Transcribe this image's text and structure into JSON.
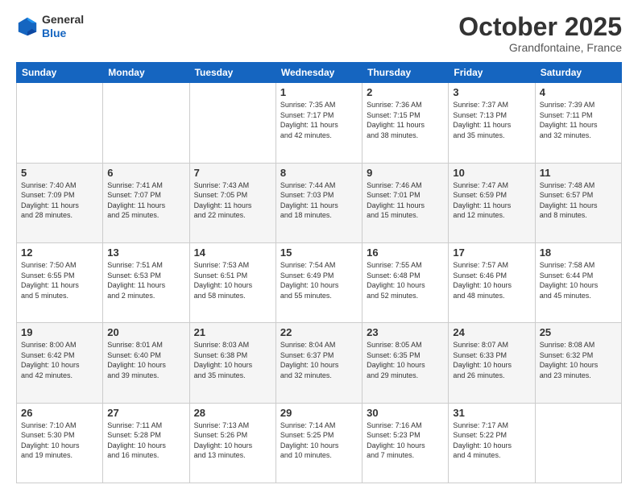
{
  "header": {
    "logo_line1": "General",
    "logo_line2": "Blue",
    "month": "October 2025",
    "location": "Grandfontaine, France"
  },
  "days_of_week": [
    "Sunday",
    "Monday",
    "Tuesday",
    "Wednesday",
    "Thursday",
    "Friday",
    "Saturday"
  ],
  "weeks": [
    [
      {
        "day": "",
        "info": ""
      },
      {
        "day": "",
        "info": ""
      },
      {
        "day": "",
        "info": ""
      },
      {
        "day": "1",
        "info": "Sunrise: 7:35 AM\nSunset: 7:17 PM\nDaylight: 11 hours\nand 42 minutes."
      },
      {
        "day": "2",
        "info": "Sunrise: 7:36 AM\nSunset: 7:15 PM\nDaylight: 11 hours\nand 38 minutes."
      },
      {
        "day": "3",
        "info": "Sunrise: 7:37 AM\nSunset: 7:13 PM\nDaylight: 11 hours\nand 35 minutes."
      },
      {
        "day": "4",
        "info": "Sunrise: 7:39 AM\nSunset: 7:11 PM\nDaylight: 11 hours\nand 32 minutes."
      }
    ],
    [
      {
        "day": "5",
        "info": "Sunrise: 7:40 AM\nSunset: 7:09 PM\nDaylight: 11 hours\nand 28 minutes."
      },
      {
        "day": "6",
        "info": "Sunrise: 7:41 AM\nSunset: 7:07 PM\nDaylight: 11 hours\nand 25 minutes."
      },
      {
        "day": "7",
        "info": "Sunrise: 7:43 AM\nSunset: 7:05 PM\nDaylight: 11 hours\nand 22 minutes."
      },
      {
        "day": "8",
        "info": "Sunrise: 7:44 AM\nSunset: 7:03 PM\nDaylight: 11 hours\nand 18 minutes."
      },
      {
        "day": "9",
        "info": "Sunrise: 7:46 AM\nSunset: 7:01 PM\nDaylight: 11 hours\nand 15 minutes."
      },
      {
        "day": "10",
        "info": "Sunrise: 7:47 AM\nSunset: 6:59 PM\nDaylight: 11 hours\nand 12 minutes."
      },
      {
        "day": "11",
        "info": "Sunrise: 7:48 AM\nSunset: 6:57 PM\nDaylight: 11 hours\nand 8 minutes."
      }
    ],
    [
      {
        "day": "12",
        "info": "Sunrise: 7:50 AM\nSunset: 6:55 PM\nDaylight: 11 hours\nand 5 minutes."
      },
      {
        "day": "13",
        "info": "Sunrise: 7:51 AM\nSunset: 6:53 PM\nDaylight: 11 hours\nand 2 minutes."
      },
      {
        "day": "14",
        "info": "Sunrise: 7:53 AM\nSunset: 6:51 PM\nDaylight: 10 hours\nand 58 minutes."
      },
      {
        "day": "15",
        "info": "Sunrise: 7:54 AM\nSunset: 6:49 PM\nDaylight: 10 hours\nand 55 minutes."
      },
      {
        "day": "16",
        "info": "Sunrise: 7:55 AM\nSunset: 6:48 PM\nDaylight: 10 hours\nand 52 minutes."
      },
      {
        "day": "17",
        "info": "Sunrise: 7:57 AM\nSunset: 6:46 PM\nDaylight: 10 hours\nand 48 minutes."
      },
      {
        "day": "18",
        "info": "Sunrise: 7:58 AM\nSunset: 6:44 PM\nDaylight: 10 hours\nand 45 minutes."
      }
    ],
    [
      {
        "day": "19",
        "info": "Sunrise: 8:00 AM\nSunset: 6:42 PM\nDaylight: 10 hours\nand 42 minutes."
      },
      {
        "day": "20",
        "info": "Sunrise: 8:01 AM\nSunset: 6:40 PM\nDaylight: 10 hours\nand 39 minutes."
      },
      {
        "day": "21",
        "info": "Sunrise: 8:03 AM\nSunset: 6:38 PM\nDaylight: 10 hours\nand 35 minutes."
      },
      {
        "day": "22",
        "info": "Sunrise: 8:04 AM\nSunset: 6:37 PM\nDaylight: 10 hours\nand 32 minutes."
      },
      {
        "day": "23",
        "info": "Sunrise: 8:05 AM\nSunset: 6:35 PM\nDaylight: 10 hours\nand 29 minutes."
      },
      {
        "day": "24",
        "info": "Sunrise: 8:07 AM\nSunset: 6:33 PM\nDaylight: 10 hours\nand 26 minutes."
      },
      {
        "day": "25",
        "info": "Sunrise: 8:08 AM\nSunset: 6:32 PM\nDaylight: 10 hours\nand 23 minutes."
      }
    ],
    [
      {
        "day": "26",
        "info": "Sunrise: 7:10 AM\nSunset: 5:30 PM\nDaylight: 10 hours\nand 19 minutes."
      },
      {
        "day": "27",
        "info": "Sunrise: 7:11 AM\nSunset: 5:28 PM\nDaylight: 10 hours\nand 16 minutes."
      },
      {
        "day": "28",
        "info": "Sunrise: 7:13 AM\nSunset: 5:26 PM\nDaylight: 10 hours\nand 13 minutes."
      },
      {
        "day": "29",
        "info": "Sunrise: 7:14 AM\nSunset: 5:25 PM\nDaylight: 10 hours\nand 10 minutes."
      },
      {
        "day": "30",
        "info": "Sunrise: 7:16 AM\nSunset: 5:23 PM\nDaylight: 10 hours\nand 7 minutes."
      },
      {
        "day": "31",
        "info": "Sunrise: 7:17 AM\nSunset: 5:22 PM\nDaylight: 10 hours\nand 4 minutes."
      },
      {
        "day": "",
        "info": ""
      }
    ]
  ]
}
